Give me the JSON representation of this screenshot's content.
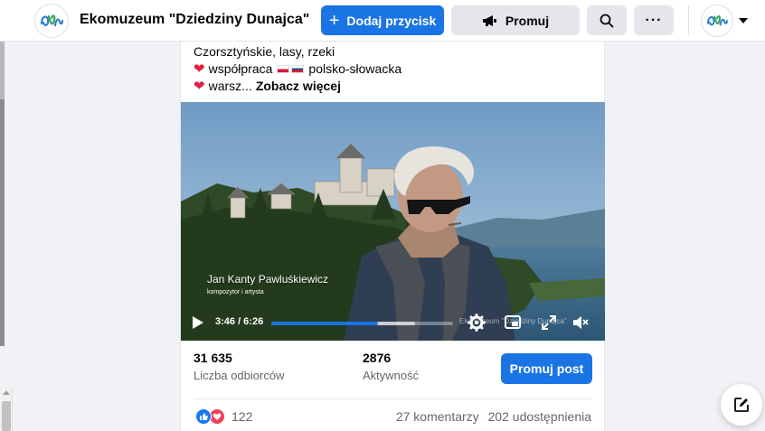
{
  "header": {
    "page_name": "Ekomuzeum \"Dziedziny Dunajca\"",
    "add_button_label": "Dodaj przycisk",
    "promote_button_label": "Promuj",
    "more_label": "···"
  },
  "post": {
    "lines": [
      "Czorsztyńskie, lasy, rzeki",
      "współpraca",
      "polsko-słowacka",
      "warsz..."
    ],
    "see_more": "Zobacz więcej"
  },
  "video": {
    "person_name": "Jan Kanty Pawluśkiewicz",
    "person_role": "kompozytor i artysta",
    "watermark": "Ekomuzeum \"Dziedziny Dunajca\"",
    "time": "3:46 / 6:26",
    "progress": 0.585,
    "buffered": 0.79
  },
  "stats": {
    "reach_value": "31 635",
    "reach_label": "Liczba odbiorców",
    "engagement_value": "2876",
    "engagement_label": "Aktywność",
    "promote_post_label": "Promuj post"
  },
  "engagement": {
    "reactions_count": "122",
    "comments": "27 komentarzy",
    "shares": "202 udostępnienia"
  },
  "colors": {
    "primary": "#1b74e4",
    "heart": "#e41e3f",
    "like": "#1877f2",
    "love": "#f33e58"
  }
}
